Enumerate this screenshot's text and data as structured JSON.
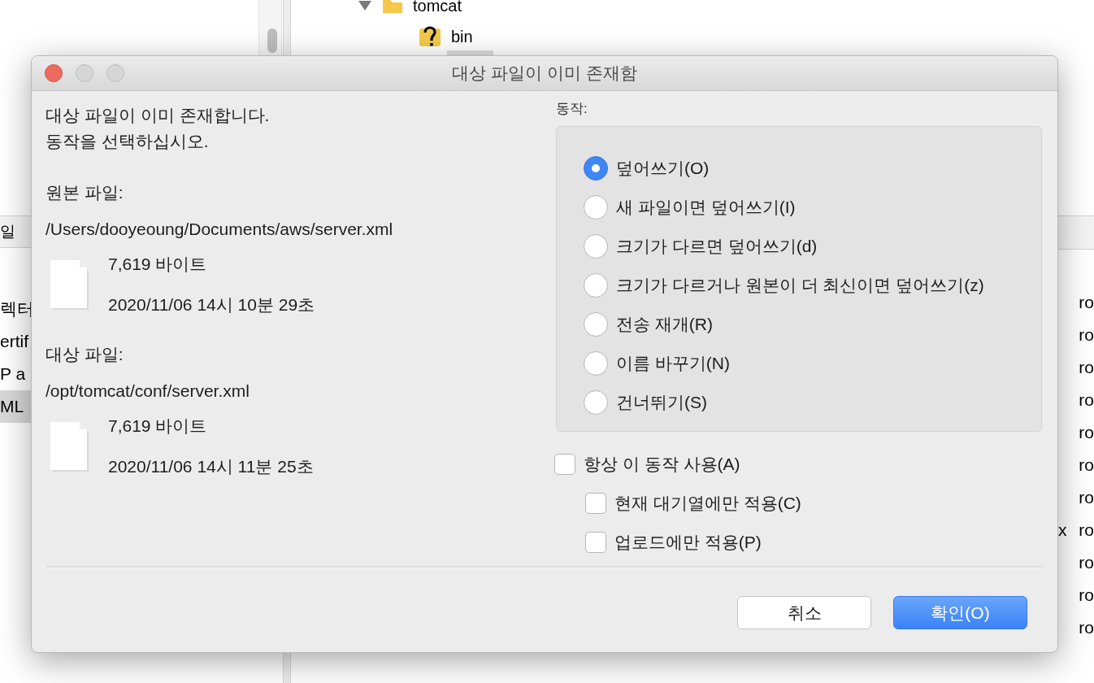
{
  "background": {
    "tree": [
      {
        "label": "tomcat",
        "expanded": true,
        "children": [
          {
            "label": "bin",
            "kind": "unknown"
          }
        ]
      }
    ],
    "left_list": {
      "header": "일",
      "rows": [
        {
          "text": "렉터",
          "selected": false
        },
        {
          "text": "ertif",
          "selected": false
        },
        {
          "text": "P a",
          "selected": false
        },
        {
          "text": "ML",
          "selected": true
        }
      ]
    },
    "right_list": {
      "rows": [
        {
          "column_2": "ro"
        },
        {
          "column_2": "ro"
        },
        {
          "column_2": "ro"
        },
        {
          "column_2": "ro"
        },
        {
          "column_2": "ro"
        },
        {
          "column_2": "ro"
        },
        {
          "column_2": "ro"
        },
        {
          "column_1": "x",
          "column_2": "ro"
        },
        {
          "column_2": "ro"
        },
        {
          "column_2": "ro"
        },
        {
          "column_2": "ro"
        }
      ]
    }
  },
  "dialog": {
    "title": "대상 파일이 이미 존재함",
    "message": [
      "대상 파일이 이미 존재합니다.",
      "동작을 선택하십시오."
    ],
    "files": [
      {
        "label": "원본 파일:",
        "path": "/Users/dooyeoung/Documents/aws/server.xml",
        "size": "7,619 바이트",
        "modified": "2020/11/06 14시 10분 29초"
      },
      {
        "label": "대상 파일:",
        "path": "/opt/tomcat/conf/server.xml",
        "size": "7,619 바이트",
        "modified": "2020/11/06 14시 11분 25초"
      }
    ],
    "actions_label": "동작:",
    "actions": [
      {
        "label": "덮어쓰기(O)",
        "selected": true
      },
      {
        "label": "새 파일이면 덮어쓰기(I)",
        "selected": false
      },
      {
        "label": "크기가 다르면 덮어쓰기(d)",
        "selected": false
      },
      {
        "label": "크기가 다르거나 원본이 더 최신이면 덮어쓰기(z)",
        "selected": false
      },
      {
        "label": "전송 재개(R)",
        "selected": false
      },
      {
        "label": "이름 바꾸기(N)",
        "selected": false
      },
      {
        "label": "건너뛰기(S)",
        "selected": false
      }
    ],
    "options": [
      {
        "label": "항상 이 동작 사용(A)",
        "checked": false,
        "children": [
          {
            "label": "현재 대기열에만 적용(C)",
            "checked": false
          },
          {
            "label": "업로드에만 적용(P)",
            "checked": false
          }
        ]
      }
    ],
    "buttons": [
      {
        "label": "취소",
        "kind": "normal"
      },
      {
        "label": "확인(O)",
        "kind": "default"
      }
    ]
  }
}
